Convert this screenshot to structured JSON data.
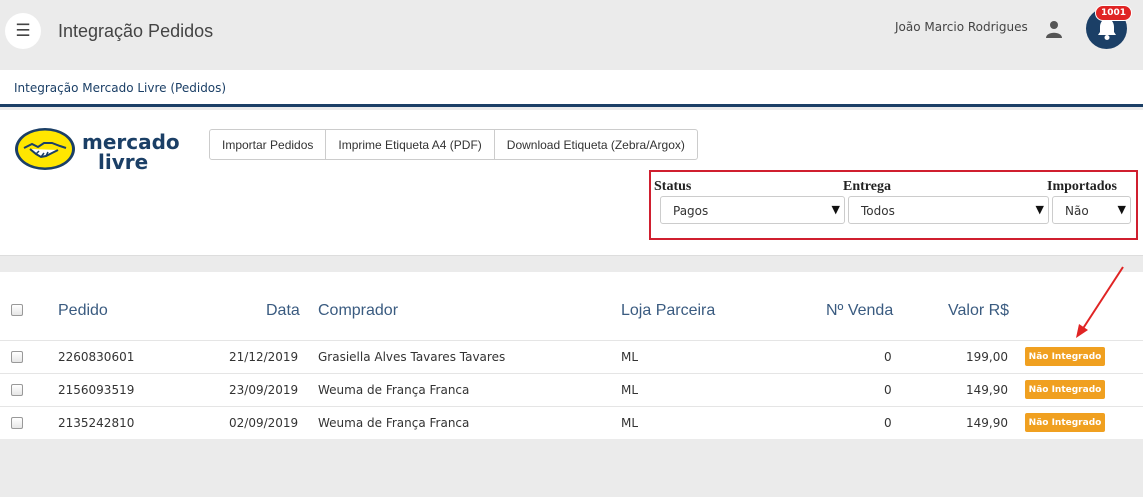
{
  "header": {
    "title": "Integração Pedidos",
    "user_name": "João Marcio Rodrigues",
    "notification_count": "1001"
  },
  "breadcrumb": "Integração Mercado Livre (Pedidos)",
  "logo_text": {
    "line1": "mercado",
    "line2": "livre"
  },
  "toolbar": {
    "buttons": [
      "Importar Pedidos",
      "Imprime Etiqueta A4 (PDF)",
      "Download Etiqueta (Zebra/Argox)"
    ]
  },
  "filters": {
    "status": {
      "label": "Status",
      "value": "Pagos"
    },
    "entrega": {
      "label": "Entrega",
      "value": "Todos"
    },
    "importados": {
      "label": "Importados",
      "value": "Não"
    }
  },
  "table": {
    "headers": [
      "Pedido",
      "Data",
      "Comprador",
      "Loja Parceira",
      "Nº Venda",
      "Valor R$"
    ],
    "rows": [
      {
        "pedido": "2260830601",
        "data": "21/12/2019",
        "comprador": "Grasiella Alves Tavares Tavares",
        "loja": "ML",
        "venda": "0",
        "valor": "199,00",
        "status": "Não Integrado"
      },
      {
        "pedido": "2156093519",
        "data": "23/09/2019",
        "comprador": "Weuma de França Franca",
        "loja": "ML",
        "venda": "0",
        "valor": "149,90",
        "status": "Não Integrado"
      },
      {
        "pedido": "2135242810",
        "data": "02/09/2019",
        "comprador": "Weuma de França Franca",
        "loja": "ML",
        "venda": "0",
        "valor": "149,90",
        "status": "Não Integrado"
      }
    ]
  },
  "colors": {
    "primary": "#1b3f66",
    "status_badge": "#f0a020",
    "highlight": "#d01f2f"
  }
}
